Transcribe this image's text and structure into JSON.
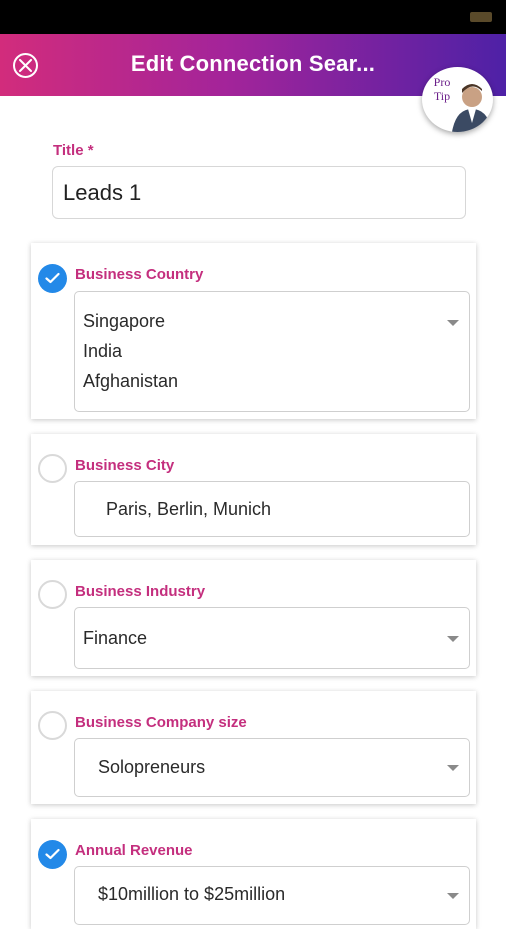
{
  "header": {
    "title": "Edit Connection Sear...",
    "pro_tip": "Pro Tip"
  },
  "title_field": {
    "label": "Title *",
    "value": "Leads 1"
  },
  "filters": {
    "country": {
      "label": "Business Country",
      "checked": true,
      "values": [
        "Singapore",
        "India",
        "Afghanistan"
      ]
    },
    "city": {
      "label": "Business City",
      "checked": false,
      "value": "Paris, Berlin, Munich"
    },
    "industry": {
      "label": "Business Industry",
      "checked": false,
      "value": "Finance"
    },
    "company_size": {
      "label": "Business Company size",
      "checked": false,
      "value": "Solopreneurs"
    },
    "revenue": {
      "label": "Annual Revenue",
      "checked": true,
      "value": "$10million to $25million"
    }
  },
  "colors": {
    "accent": "#c42f7e",
    "check": "#2389e8",
    "header_start": "#d22c7c",
    "header_end": "#4e21a6"
  },
  "icons": {
    "close": "close-circle-icon",
    "check": "checkmark-icon",
    "dropdown": "caret-down-icon",
    "avatar": "pro-tip-avatar"
  }
}
